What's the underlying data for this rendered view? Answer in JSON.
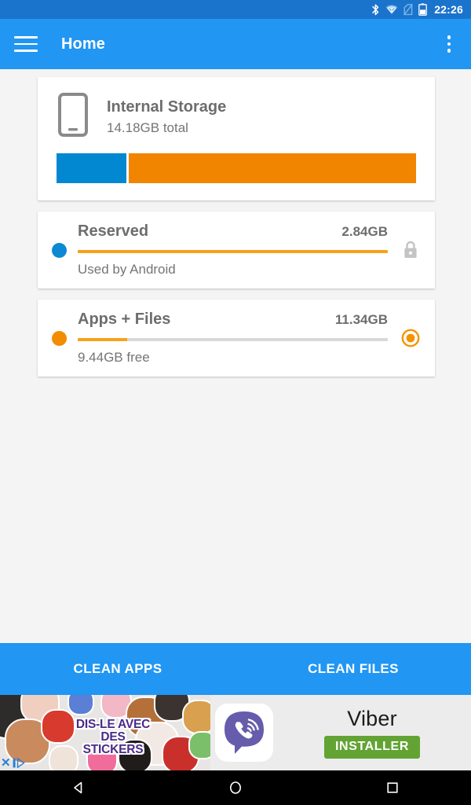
{
  "status_bar": {
    "time": "22:26",
    "icons": [
      "bluetooth-icon",
      "wifi-icon",
      "sim-off-icon",
      "battery-icon"
    ],
    "background_color": "#1b74cc"
  },
  "app_bar": {
    "title": "Home",
    "menu_icon": "hamburger-menu-icon",
    "overflow_icon": "overflow-menu-icon",
    "background_color": "#2196f3"
  },
  "internal_storage": {
    "icon": "phone-icon",
    "title": "Internal Storage",
    "subtitle": "14.18GB total",
    "bar": {
      "reserved_percent": 19.5,
      "apps_percent": 80.5,
      "reserved_color": "#0288d1",
      "apps_color": "#f28500"
    }
  },
  "storage_items": [
    {
      "bullet_color": "#0d88d3",
      "title": "Reserved",
      "value": "2.84GB",
      "subtitle": "Used by Android",
      "progress_percent": 100,
      "action_icon": "lock-icon",
      "action_interactable": "false"
    },
    {
      "bullet_color": "#f28d00",
      "title": "Apps + Files",
      "value": "11.34GB",
      "subtitle": "9.44GB free",
      "progress_percent": 16,
      "action_icon": "radio-selected-icon",
      "action_interactable": "true"
    }
  ],
  "action_bar": {
    "clean_apps_label": "CLEAN APPS",
    "clean_files_label": "CLEAN FILES"
  },
  "ad": {
    "artwork_text": "DIS-LE AVEC DES STICKERS",
    "logo_icon": "viber-logo-icon",
    "title": "Viber",
    "cta_label": "INSTALLER",
    "cta_color": "#63a333",
    "adchoices_icon": "adchoices-icon"
  },
  "nav_bar": {
    "back_icon": "back-triangle-icon",
    "home_icon": "home-circle-icon",
    "recents_icon": "recents-square-icon"
  }
}
